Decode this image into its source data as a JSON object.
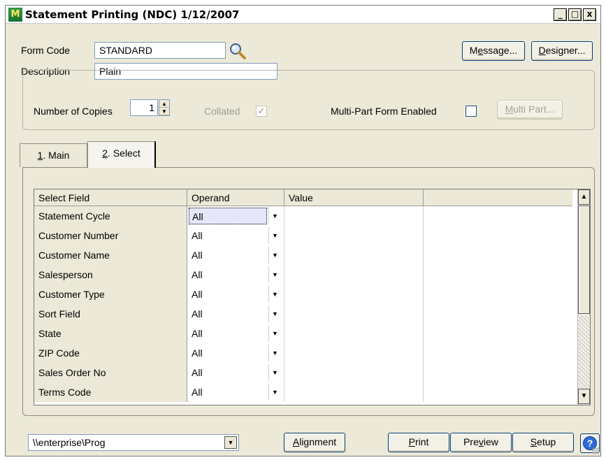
{
  "window": {
    "title": "Statement Printing (NDC) 1/12/2007",
    "controls": {
      "minimize": "_",
      "maximize": "□",
      "close": "x"
    }
  },
  "header": {
    "form_code_label": "Form Code",
    "form_code_value": "STANDARD",
    "description_label": "Description",
    "description_value": "Plain",
    "message_button": {
      "pre": "M",
      "ul": "e",
      "post": "ssage..."
    },
    "designer_button": {
      "pre": "",
      "ul": "D",
      "post": "esigner..."
    }
  },
  "options": {
    "copies_label": "Number of Copies",
    "copies_value": "1",
    "collated_label": "Collated",
    "collated_checked": true,
    "multipart_label": "Multi-Part Form Enabled",
    "multipart_checked": false,
    "multipart_button": {
      "pre": "",
      "ul": "M",
      "post": "ulti Part..."
    }
  },
  "tabs": [
    {
      "ul": "1",
      "rest": ". Main",
      "active": false
    },
    {
      "ul": "2",
      "rest": ". Select",
      "active": true
    }
  ],
  "grid": {
    "columns": [
      "Select Field",
      "Operand",
      "Value",
      ""
    ],
    "rows": [
      {
        "field": "Statement Cycle",
        "operand": "All",
        "value": ""
      },
      {
        "field": "Customer Number",
        "operand": "All",
        "value": ""
      },
      {
        "field": "Customer Name",
        "operand": "All",
        "value": ""
      },
      {
        "field": "Salesperson",
        "operand": "All",
        "value": ""
      },
      {
        "field": "Customer Type",
        "operand": "All",
        "value": ""
      },
      {
        "field": "Sort Field",
        "operand": "All",
        "value": ""
      },
      {
        "field": "State",
        "operand": "All",
        "value": ""
      },
      {
        "field": "ZIP Code",
        "operand": "All",
        "value": ""
      },
      {
        "field": "Sales Order No",
        "operand": "All",
        "value": ""
      },
      {
        "field": "Terms Code",
        "operand": "All",
        "value": ""
      }
    ]
  },
  "footer": {
    "printer_path": "\\\\enterprise\\Prog",
    "alignment_button": {
      "pre": "",
      "ul": "A",
      "post": "lignment"
    },
    "print_button": {
      "pre": "",
      "ul": "P",
      "post": "rint"
    },
    "preview_button": {
      "pre": "Pre",
      "ul": "v",
      "post": "iew"
    },
    "setup_button": {
      "pre": "",
      "ul": "S",
      "post": "etup"
    },
    "help_glyph": "?"
  },
  "icons": {
    "app": "app-icon",
    "lookup": "magnifier-icon",
    "dropdown": "▼",
    "up": "▲",
    "check": "✓"
  }
}
